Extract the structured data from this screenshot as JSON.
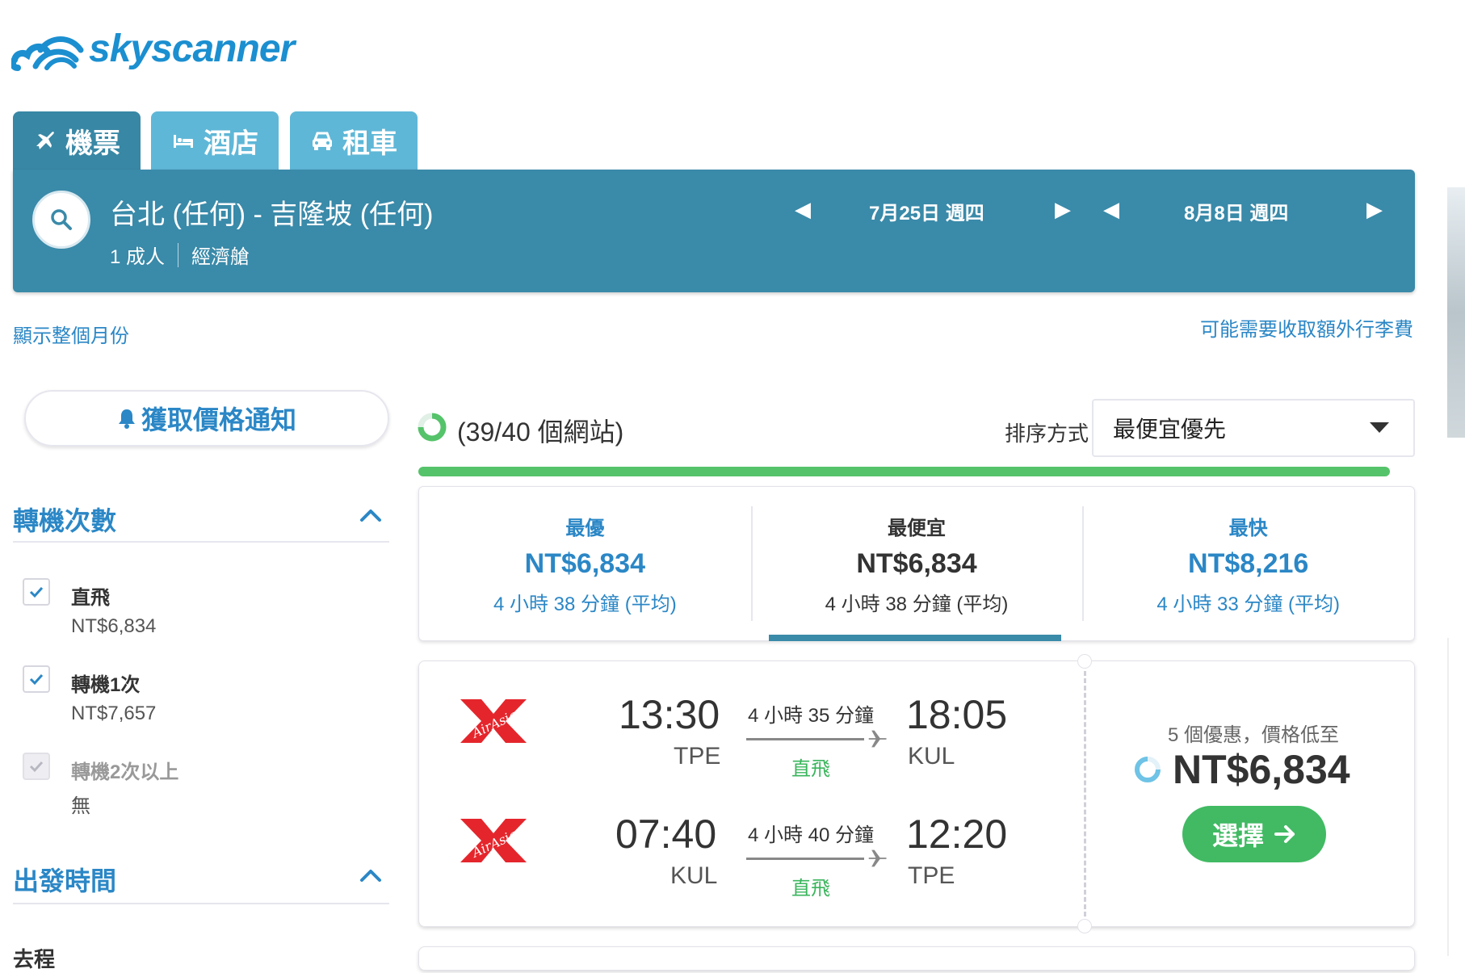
{
  "brand": {
    "name": "skyscanner",
    "color": "#1b8fd0"
  },
  "tabs": [
    {
      "label": "機票",
      "icon": "plane-icon",
      "active": true
    },
    {
      "label": "酒店",
      "icon": "bed-icon",
      "active": false
    },
    {
      "label": "租車",
      "icon": "car-icon",
      "active": false
    }
  ],
  "search": {
    "route": "台北 (任何) - 吉隆坡 (任何)",
    "travellers": "1 成人",
    "cabin": "經濟艙",
    "depart_date": "7月25日 週四",
    "return_date": "8月8日 週四"
  },
  "links": {
    "whole_month": "顯示整個月份",
    "baggage_fee": "可能需要收取額外行李費"
  },
  "sidebar": {
    "alert_label": "獲取價格通知",
    "stops_title": "轉機次數",
    "stops": [
      {
        "label": "直飛",
        "price": "NT$6,834",
        "checked": true,
        "disabled": false
      },
      {
        "label": "轉機1次",
        "price": "NT$7,657",
        "checked": true,
        "disabled": false
      },
      {
        "label": "轉機2次以上",
        "price": "無",
        "checked": true,
        "disabled": true
      }
    ],
    "departure_title": "出發時間",
    "outbound_label": "去程"
  },
  "results": {
    "sites_status": "(39/40 個網站)",
    "sort_label": "排序方式",
    "sort_value": "最便宜優先",
    "progress": 0.975
  },
  "summary": [
    {
      "title": "最優",
      "price": "NT$6,834",
      "duration": "4 小時 38 分鐘 (平均)",
      "active": false
    },
    {
      "title": "最便宜",
      "price": "NT$6,834",
      "duration": "4 小時 38 分鐘 (平均)",
      "active": true
    },
    {
      "title": "最快",
      "price": "NT$8,216",
      "duration": "4 小時 33 分鐘 (平均)",
      "active": false
    }
  ],
  "flight": {
    "airline": "AirAsia",
    "legs": [
      {
        "depart_time": "13:30",
        "depart_airport": "TPE",
        "duration": "4 小時 35 分鐘",
        "stops": "直飛",
        "arrive_time": "18:05",
        "arrive_airport": "KUL"
      },
      {
        "depart_time": "07:40",
        "depart_airport": "KUL",
        "duration": "4 小時 40 分鐘",
        "stops": "直飛",
        "arrive_time": "12:20",
        "arrive_airport": "TPE"
      }
    ],
    "deals_text": "5 個優惠，價格低至",
    "price": "NT$6,834",
    "select_label": "選擇"
  },
  "colors": {
    "accent": "#3a8aa9",
    "tab_inactive": "#5fb7d7",
    "link": "#2b87c6",
    "green": "#41ba63",
    "airasia_red": "#e4262c"
  }
}
